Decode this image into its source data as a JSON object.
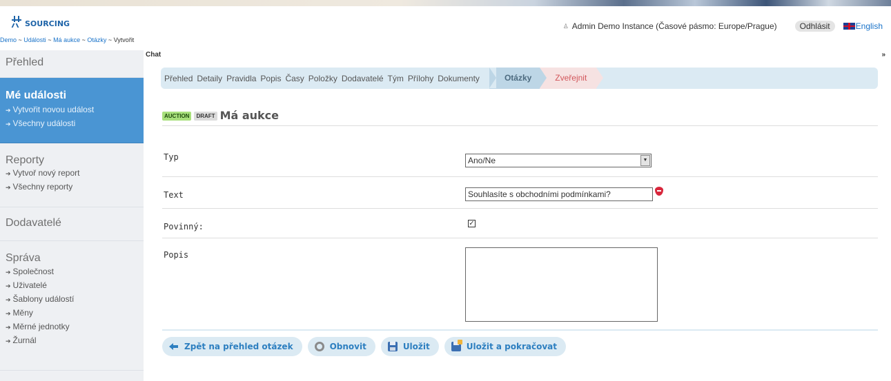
{
  "header": {
    "logo_text": "SOURCING",
    "user_info": "Admin Demo Instance (Časové pásmo: Europe/Prague)",
    "logout_label": "Odhlásit",
    "language_label": "English"
  },
  "breadcrumb": {
    "items": [
      "Demo",
      "Události",
      "Má aukce",
      "Otázky"
    ],
    "separator": " ~ ",
    "current": "Vytvořit"
  },
  "chat": {
    "label": "Chat",
    "toggle": "»"
  },
  "sidebar": {
    "overview": "Přehled",
    "my_events": {
      "title": "Mé události",
      "links": [
        "Vytvořit novou událost",
        "Všechny události"
      ]
    },
    "reports": {
      "title": "Reporty",
      "links": [
        "Vytvoř nový report",
        "Všechny reporty"
      ]
    },
    "suppliers": "Dodavatelé",
    "admin": {
      "title": "Správa",
      "links": [
        "Společnost",
        "Uživatelé",
        "Šablony událostí",
        "Měny",
        "Měrné jednotky",
        "Žurnál"
      ]
    }
  },
  "tabs": {
    "items": [
      "Přehled",
      "Detaily",
      "Pravidla",
      "Popis",
      "Časy",
      "Položky",
      "Dodavatelé",
      "Tým",
      "Přílohy",
      "Dokumenty"
    ],
    "active": "Otázky",
    "next": "Zveřejnit"
  },
  "event": {
    "badge_type": "AUCTION",
    "badge_status": "DRAFT",
    "title": "Má aukce"
  },
  "form": {
    "type_label": "Typ",
    "type_value": "Ano/Ne",
    "text_label": "Text",
    "text_value": "Souhlasíte s obchodními podmínkami?",
    "required_label": "Povinný:",
    "required_checked": true,
    "description_label": "Popis",
    "description_value": ""
  },
  "buttons": {
    "back": "Zpět na přehled otázek",
    "reset": "Obnovit",
    "save": "Uložit",
    "save_continue": "Uložit a pokračovat"
  },
  "colors": {
    "accent": "#4a95d3",
    "link": "#1a73c9",
    "tab_bg": "#dbeaf3",
    "next_tab": "#d2555a",
    "badge_auction": "#a8e07c"
  }
}
